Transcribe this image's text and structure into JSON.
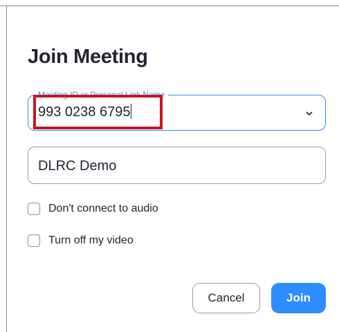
{
  "dialog": {
    "title": "Join Meeting"
  },
  "meeting_id_field": {
    "label": "Meeting ID or Personal Link Name",
    "value": "993 0238 6795",
    "dropdown_icon": "chevron-down-icon"
  },
  "name_field": {
    "value": "DLRC Demo"
  },
  "options": {
    "no_audio_label": "Don't connect to audio",
    "no_audio_checked": false,
    "video_off_label": "Turn off my video",
    "video_off_checked": false
  },
  "buttons": {
    "cancel_label": "Cancel",
    "join_label": "Join"
  },
  "colors": {
    "accent": "#2d8cff",
    "highlight": "#c8161c",
    "text": "#232333"
  }
}
